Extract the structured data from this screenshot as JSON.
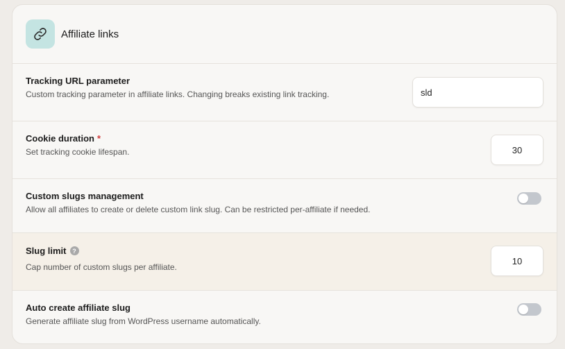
{
  "card": {
    "title": "Affiliate links",
    "icon": "link-icon"
  },
  "settings": [
    {
      "title": "Tracking URL parameter",
      "description": "Custom tracking parameter in affiliate links. Changing breaks existing link tracking.",
      "value": "sld"
    },
    {
      "title": "Cookie duration",
      "required_mark": "*",
      "description": "Set tracking cookie lifespan.",
      "value": "30"
    },
    {
      "title": "Custom slugs management",
      "description": "Allow all affiliates to create or delete custom link slug. Can be restricted per-affiliate if needed.",
      "enabled": false
    },
    {
      "title": "Slug limit",
      "help_icon": "?",
      "description": "Cap number of custom slugs per affiliate.",
      "value": "10"
    },
    {
      "title": "Auto create affiliate slug",
      "description": "Generate affiliate slug from WordPress username automatically.",
      "enabled": false
    }
  ],
  "colors": {
    "icon_bg": "#c4e4e2",
    "highlight_row": "#f5f0e8",
    "toggle_off": "#c3c7cd",
    "required": "#d03a3a"
  }
}
